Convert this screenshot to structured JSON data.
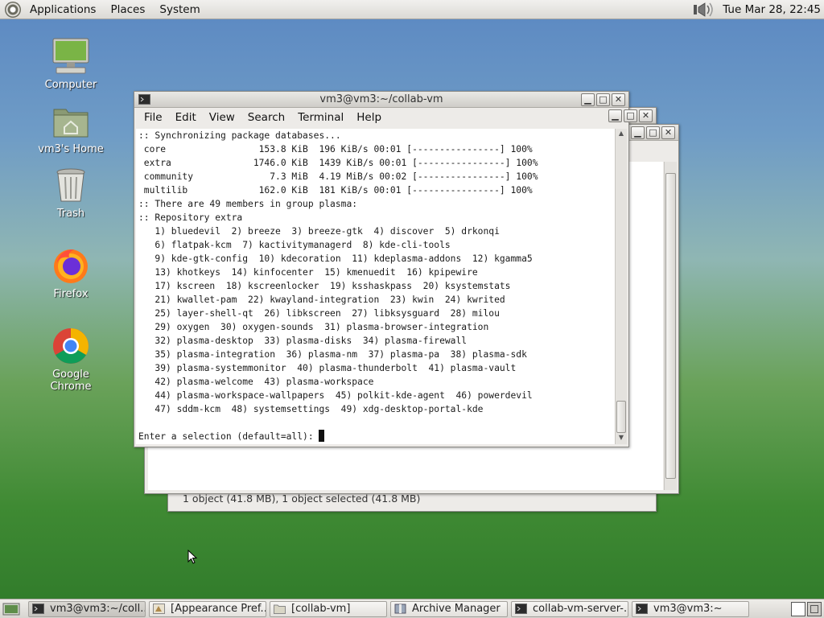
{
  "top_panel": {
    "menus": [
      "Applications",
      "Places",
      "System"
    ],
    "clock": "Tue Mar 28, 22:45"
  },
  "desktop_icons": [
    {
      "label": "Computer",
      "icon": "computer-icon"
    },
    {
      "label": "vm3's Home",
      "icon": "home-folder-icon"
    },
    {
      "label": "Trash",
      "icon": "trash-icon"
    },
    {
      "label": "Firefox",
      "icon": "firefox-icon"
    },
    {
      "label": "Google Chrome",
      "icon": "chrome-icon"
    }
  ],
  "terminal": {
    "title": "vm3@vm3:~/collab-vm",
    "menus": [
      "File",
      "Edit",
      "View",
      "Search",
      "Terminal",
      "Help"
    ],
    "lines": [
      ":: Synchronizing package databases...",
      " core                 153.8 KiB  196 KiB/s 00:01 [----------------] 100%",
      " extra               1746.0 KiB  1439 KiB/s 00:01 [----------------] 100%",
      " community              7.3 MiB  4.19 MiB/s 00:02 [----------------] 100%",
      " multilib             162.0 KiB  181 KiB/s 00:01 [----------------] 100%",
      ":: There are 49 members in group plasma:",
      ":: Repository extra",
      "   1) bluedevil  2) breeze  3) breeze-gtk  4) discover  5) drkonqi",
      "   6) flatpak-kcm  7) kactivitymanagerd  8) kde-cli-tools",
      "   9) kde-gtk-config  10) kdecoration  11) kdeplasma-addons  12) kgamma5",
      "   13) khotkeys  14) kinfocenter  15) kmenuedit  16) kpipewire",
      "   17) kscreen  18) kscreenlocker  19) ksshaskpass  20) ksystemstats",
      "   21) kwallet-pam  22) kwayland-integration  23) kwin  24) kwrited",
      "   25) layer-shell-qt  26) libkscreen  27) libksysguard  28) milou",
      "   29) oxygen  30) oxygen-sounds  31) plasma-browser-integration",
      "   32) plasma-desktop  33) plasma-disks  34) plasma-firewall",
      "   35) plasma-integration  36) plasma-nm  37) plasma-pa  38) plasma-sdk",
      "   39) plasma-systemmonitor  40) plasma-thunderbolt  41) plasma-vault",
      "   42) plasma-welcome  43) plasma-workspace",
      "   44) plasma-workspace-wallpapers  45) polkit-kde-agent  46) powerdevil",
      "   47) sddm-kcm  48) systemsettings  49) xdg-desktop-portal-kde",
      "",
      "Enter a selection (default=all): "
    ]
  },
  "background_window": {
    "status": "1 object (41.8 MB), 1 object selected (41.8 MB)"
  },
  "taskbar": {
    "tasks": [
      {
        "label": "vm3@vm3:~/coll...",
        "icon": "terminal-icon"
      },
      {
        "label": "[Appearance Pref...",
        "icon": "appearance-icon"
      },
      {
        "label": "[collab-vm]",
        "icon": "folder-icon"
      },
      {
        "label": "Archive Manager",
        "icon": "archive-icon"
      },
      {
        "label": "collab-vm-server-...",
        "icon": "terminal-icon"
      },
      {
        "label": "vm3@vm3:~",
        "icon": "terminal-icon"
      }
    ]
  }
}
